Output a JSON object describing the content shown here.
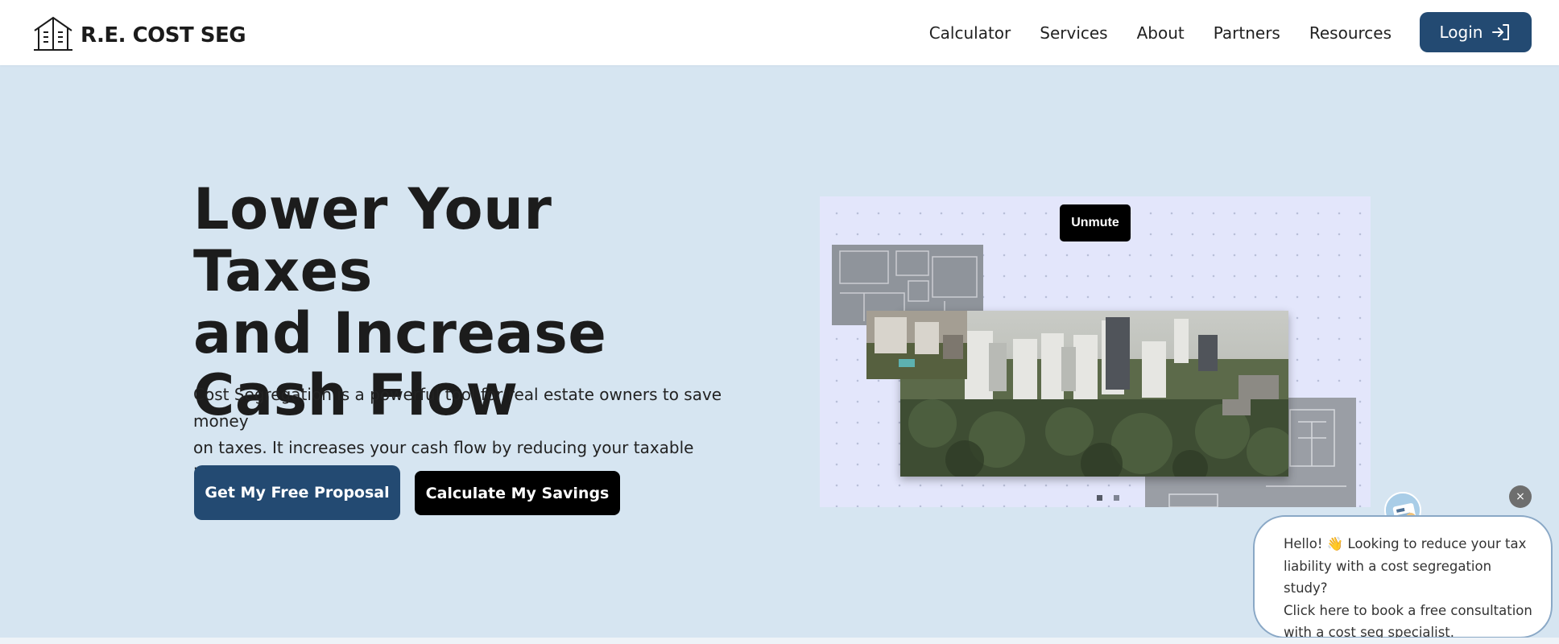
{
  "brand": {
    "name": "R.E. COST SEG"
  },
  "nav": {
    "items": [
      {
        "label": "Calculator"
      },
      {
        "label": "Services"
      },
      {
        "label": "About"
      },
      {
        "label": "Partners"
      },
      {
        "label": "Resources"
      }
    ],
    "login_label": "Login"
  },
  "hero": {
    "title_lines": [
      "Lower Your Taxes",
      "and Increase",
      "Cash Flow"
    ],
    "description_lines": [
      "Cost Segregation is a powerful tool for real estate owners to save money",
      "on taxes. It increases your cash flow by reducing your taxable income."
    ],
    "primary_cta": "Get My Free Proposal",
    "secondary_cta": "Calculate My Savings"
  },
  "video": {
    "unmute_label": "Unmute",
    "slide_count": 2,
    "active_slide": 1
  },
  "chat": {
    "close_symbol": "×",
    "message_lines": [
      "Hello! 👋 Looking to reduce your tax",
      "liability with a cost segregation study?",
      "Click here to book a free consultation",
      "with a cost seg specialist."
    ]
  },
  "colors": {
    "brand_navy": "#234a72",
    "hero_background": "#d6e5f1",
    "black_button": "#000000"
  },
  "icons": [
    "building-logo-icon",
    "login-arrow-icon",
    "chat-avatar-icon",
    "close-icon"
  ]
}
